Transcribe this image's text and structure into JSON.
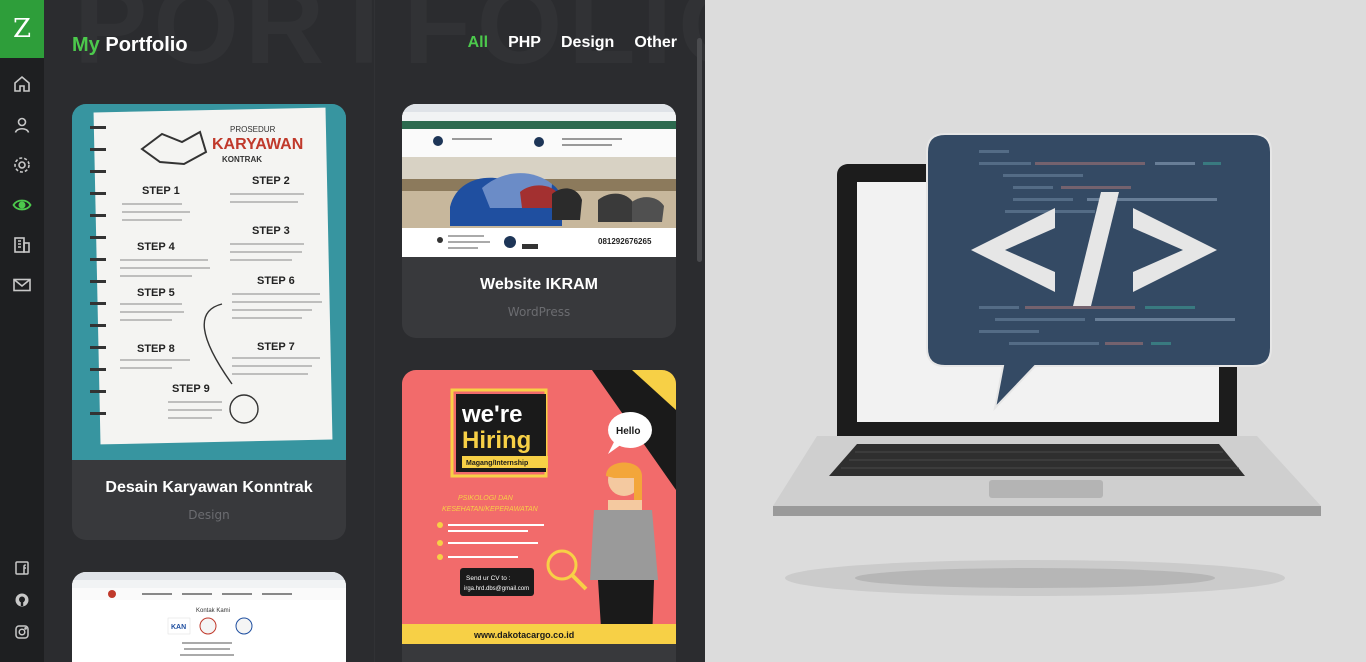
{
  "sidebar": {
    "logo": "Z",
    "nav": [
      {
        "icon": "home-icon"
      },
      {
        "icon": "user-icon"
      },
      {
        "icon": "gear-icon"
      },
      {
        "icon": "eye-icon",
        "active": true
      },
      {
        "icon": "building-icon"
      },
      {
        "icon": "mail-icon"
      }
    ],
    "social": [
      {
        "icon": "facebook-icon"
      },
      {
        "icon": "github-icon"
      },
      {
        "icon": "instagram-icon"
      }
    ]
  },
  "header": {
    "title_accent": "My",
    "title_rest": "Portfolio",
    "watermark": "PORTFOLIO"
  },
  "filters": [
    {
      "label": "All",
      "active": true
    },
    {
      "label": "PHP",
      "active": false
    },
    {
      "label": "Design",
      "active": false
    },
    {
      "label": "Other",
      "active": false
    }
  ],
  "cards": [
    {
      "title": "Desain Karyawan Konntrak",
      "category": "Design",
      "thumb": {
        "heading_top": "PROSEDUR",
        "heading_main": "KARYAWAN",
        "heading_sub": "KONTRAK",
        "steps": [
          "STEP 1",
          "STEP 2",
          "STEP 3",
          "STEP 4",
          "STEP 5",
          "STEP 6",
          "STEP 7",
          "STEP 8",
          "STEP 9"
        ]
      }
    },
    {
      "title": "Website IKRAM",
      "category": "WordPress",
      "thumb": {
        "phone": "081292676265"
      }
    },
    {
      "title": "",
      "category": "",
      "thumb": {
        "line1": "we're",
        "line2": "Hiring",
        "ribbon": "Magang/Internship",
        "bubble": "Hello",
        "field1": "PSIKOLOGI DAN",
        "field2": "KESEHATAN/KEPERAWATAN",
        "cta": "Send ur CV to :",
        "email": "irga.hrd.dbs@gmail.com",
        "website": "www.dakotacargo.co.id"
      }
    },
    {
      "title": "",
      "category": "",
      "thumb": {
        "heading": "Kontak Kami",
        "logo": "KAN"
      }
    }
  ],
  "colors": {
    "accent": "#4cc94c",
    "logo_bg": "#2e9e3a",
    "sidebar_bg": "#1e1f21",
    "panel_bg": "#2b2c2f",
    "card_bg": "#38393c",
    "hero_bg": "#dcdcdc",
    "code_bubble": "#344a64"
  }
}
